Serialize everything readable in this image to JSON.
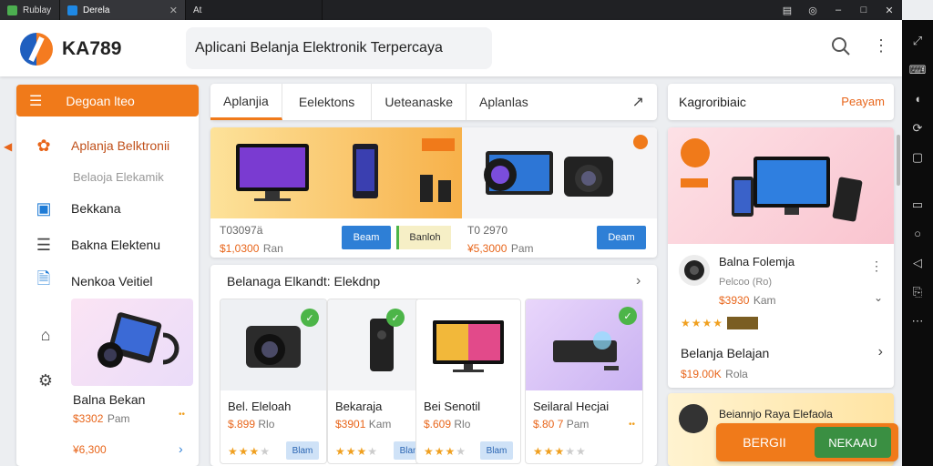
{
  "browser": {
    "tabs": [
      {
        "label": "Rublay",
        "color": "#4caf50"
      },
      {
        "label": "Derela",
        "color": "#1e88e5"
      },
      {
        "label": "At",
        "color": "#888888"
      }
    ],
    "controls": [
      "▤",
      "◎",
      "–",
      "□",
      "✕"
    ]
  },
  "header": {
    "brand": "KA789",
    "search_value": "Aplicani Belanja Elektronik Terpercaya",
    "search_icon": "search-icon",
    "more_icon": "more-vert-icon"
  },
  "sidebar": {
    "head_label": "Degoan lteo",
    "items": [
      {
        "label": "Aplanja Belktronii",
        "icon": "flower-icon"
      },
      {
        "label": "Belaoja Elekamik",
        "sub": true
      },
      {
        "label": "Bekkana",
        "icon": "folder-icon"
      },
      {
        "label": "Bakna Elektenu",
        "icon": "list-icon"
      },
      {
        "label": "Nenkoa Veitiel",
        "icon": "doc-icon"
      }
    ],
    "promo": {
      "name": "Balna Bekan",
      "price": "$3302",
      "unit": "Pam"
    },
    "footer_price": "¥6,300"
  },
  "main_tabs": [
    "Aplanjia",
    "Eelektons",
    "Ueteanaske",
    "Aplanlas"
  ],
  "featured": [
    {
      "code": "T03097ä",
      "price": "$1,0300",
      "unit": "Ran",
      "btn1": "Beam",
      "btn2": "Banloh"
    },
    {
      "code": "T0 2970",
      "price": "¥5,3000",
      "unit": "Pam",
      "btn1": "Deam"
    }
  ],
  "section": {
    "title": "Belanaga Elkandt: Elekdnp"
  },
  "products": [
    {
      "name": "Bel. Eleloah",
      "price": "$.899",
      "unit": "Rlo",
      "btn": "Blam"
    },
    {
      "name": "Bekaraja",
      "price": "$3901",
      "unit": "Kam",
      "btn": "Blam"
    },
    {
      "name": "Bei Senotil",
      "price": "$.609",
      "unit": "Rlo",
      "btn": "Blam"
    },
    {
      "name": "Seilaral Hecjai",
      "price": "$.80 7",
      "unit": "Pam",
      "btn": ""
    }
  ],
  "right_panel": {
    "title": "Kagroribiaic",
    "link": "Peayam",
    "item1": {
      "name": "Balna Folemja",
      "sub": "Pelcoo (Ro)",
      "price": "$3930",
      "unit": "Kam"
    },
    "item2": {
      "name": "Belanja Belajan",
      "price": "$19.00K",
      "unit": "Rola"
    },
    "item3": {
      "name": "Beiannjo Raya Elefaola"
    }
  },
  "bottom_buttons": {
    "primary": "BERGII",
    "secondary": "NEKAAU"
  },
  "colors": {
    "accent": "#f07a1a",
    "blue": "#2e7fd6",
    "green": "#4cb548"
  }
}
